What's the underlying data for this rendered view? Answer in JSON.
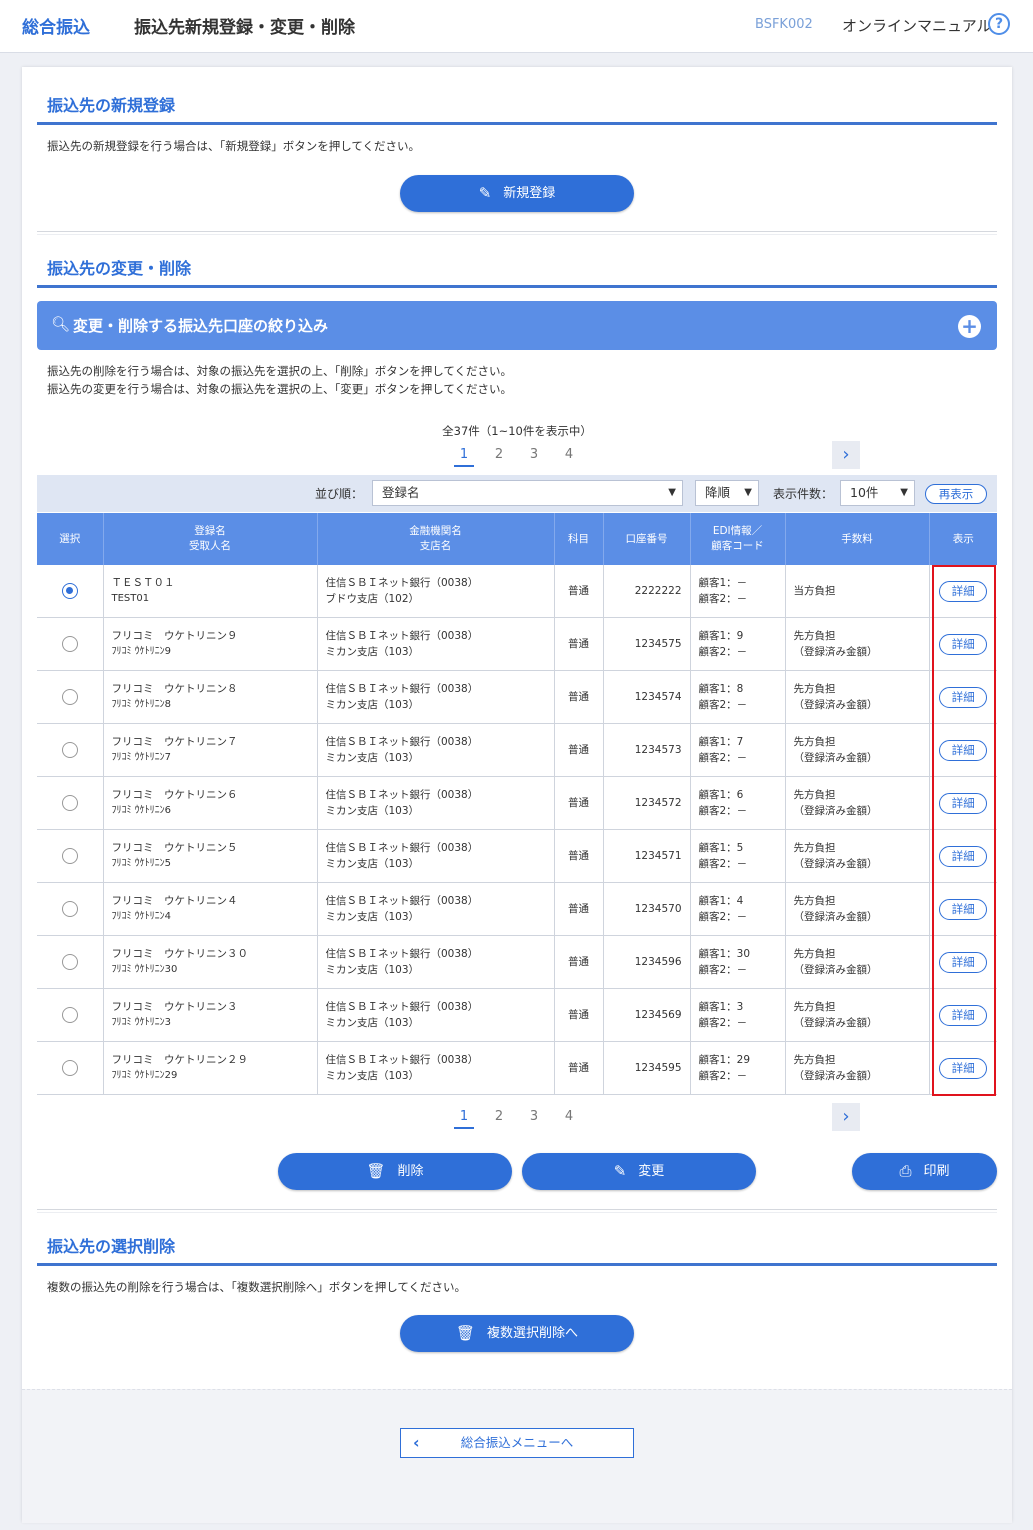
{
  "header": {
    "app_name": "総合振込",
    "screen_title": "振込先新規登録・変更・削除",
    "screen_code": "BSFK002",
    "manual_label": "オンラインマニュアル",
    "help_icon": "?"
  },
  "new_section": {
    "title": "振込先の新規登録",
    "note": "振込先の新規登録を行う場合は、「新規登録」ボタンを押してください。",
    "button": "新規登録"
  },
  "change_section": {
    "title": "振込先の変更・削除",
    "filter_label": "変更・削除する振込先口座の絞り込み",
    "note1": "振込先の削除を行う場合は、対象の振込先を選択の上、「削除」ボタンを押してください。",
    "note2": "振込先の変更を行う場合は、対象の振込先を選択の上、「変更」ボタンを押してください。",
    "count_text": "全37件（1~10件を表示中）",
    "pages": [
      "1",
      "2",
      "3",
      "4"
    ],
    "current_page": "1",
    "sort_label": "並び順：",
    "sort_value": "登録名",
    "order_value": "降順",
    "per_page_label": "表示件数：",
    "per_page_value": "10件",
    "redisplay": "再表示",
    "columns": {
      "select": "選択",
      "name1": "登録名",
      "name2": "受取人名",
      "bank1": "金融機関名",
      "bank2": "支店名",
      "type": "科目",
      "account": "口座番号",
      "edi1": "EDI情報／",
      "edi2": "顧客コード",
      "fee": "手数料",
      "view": "表示"
    },
    "detail_label": "詳細",
    "rows": [
      {
        "selected": true,
        "name": "ＴＥＳＴ０１",
        "kana": "TEST01",
        "bank": "住信ＳＢＩネット銀行（0038）",
        "branch": "ブドウ支店（102）",
        "type": "普通",
        "account": "2222222",
        "c1": "顧客1：－",
        "c2": "顧客2：－",
        "fee1": "当方負担",
        "fee2": ""
      },
      {
        "selected": false,
        "name": "フリコミ　ウケトリニン９",
        "kana": "ﾌﾘｺﾐ ｳｹﾄﾘﾆﾝ9",
        "bank": "住信ＳＢＩネット銀行（0038）",
        "branch": "ミカン支店（103）",
        "type": "普通",
        "account": "1234575",
        "c1": "顧客1：9",
        "c2": "顧客2：－",
        "fee1": "先方負担",
        "fee2": "（登録済み金額）"
      },
      {
        "selected": false,
        "name": "フリコミ　ウケトリニン８",
        "kana": "ﾌﾘｺﾐ ｳｹﾄﾘﾆﾝ8",
        "bank": "住信ＳＢＩネット銀行（0038）",
        "branch": "ミカン支店（103）",
        "type": "普通",
        "account": "1234574",
        "c1": "顧客1：8",
        "c2": "顧客2：－",
        "fee1": "先方負担",
        "fee2": "（登録済み金額）"
      },
      {
        "selected": false,
        "name": "フリコミ　ウケトリニン７",
        "kana": "ﾌﾘｺﾐ ｳｹﾄﾘﾆﾝ7",
        "bank": "住信ＳＢＩネット銀行（0038）",
        "branch": "ミカン支店（103）",
        "type": "普通",
        "account": "1234573",
        "c1": "顧客1：7",
        "c2": "顧客2：－",
        "fee1": "先方負担",
        "fee2": "（登録済み金額）"
      },
      {
        "selected": false,
        "name": "フリコミ　ウケトリニン６",
        "kana": "ﾌﾘｺﾐ ｳｹﾄﾘﾆﾝ6",
        "bank": "住信ＳＢＩネット銀行（0038）",
        "branch": "ミカン支店（103）",
        "type": "普通",
        "account": "1234572",
        "c1": "顧客1：6",
        "c2": "顧客2：－",
        "fee1": "先方負担",
        "fee2": "（登録済み金額）"
      },
      {
        "selected": false,
        "name": "フリコミ　ウケトリニン５",
        "kana": "ﾌﾘｺﾐ ｳｹﾄﾘﾆﾝ5",
        "bank": "住信ＳＢＩネット銀行（0038）",
        "branch": "ミカン支店（103）",
        "type": "普通",
        "account": "1234571",
        "c1": "顧客1：5",
        "c2": "顧客2：－",
        "fee1": "先方負担",
        "fee2": "（登録済み金額）"
      },
      {
        "selected": false,
        "name": "フリコミ　ウケトリニン４",
        "kana": "ﾌﾘｺﾐ ｳｹﾄﾘﾆﾝ4",
        "bank": "住信ＳＢＩネット銀行（0038）",
        "branch": "ミカン支店（103）",
        "type": "普通",
        "account": "1234570",
        "c1": "顧客1：4",
        "c2": "顧客2：－",
        "fee1": "先方負担",
        "fee2": "（登録済み金額）"
      },
      {
        "selected": false,
        "name": "フリコミ　ウケトリニン３０",
        "kana": "ﾌﾘｺﾐ ｳｹﾄﾘﾆﾝ30",
        "bank": "住信ＳＢＩネット銀行（0038）",
        "branch": "ミカン支店（103）",
        "type": "普通",
        "account": "1234596",
        "c1": "顧客1：30",
        "c2": "顧客2：－",
        "fee1": "先方負担",
        "fee2": "（登録済み金額）"
      },
      {
        "selected": false,
        "name": "フリコミ　ウケトリニン３",
        "kana": "ﾌﾘｺﾐ ｳｹﾄﾘﾆﾝ3",
        "bank": "住信ＳＢＩネット銀行（0038）",
        "branch": "ミカン支店（103）",
        "type": "普通",
        "account": "1234569",
        "c1": "顧客1：3",
        "c2": "顧客2：－",
        "fee1": "先方負担",
        "fee2": "（登録済み金額）"
      },
      {
        "selected": false,
        "name": "フリコミ　ウケトリニン２９",
        "kana": "ﾌﾘｺﾐ ｳｹﾄﾘﾆﾝ29",
        "bank": "住信ＳＢＩネット銀行（0038）",
        "branch": "ミカン支店（103）",
        "type": "普通",
        "account": "1234595",
        "c1": "顧客1：29",
        "c2": "顧客2：－",
        "fee1": "先方負担",
        "fee2": "（登録済み金額）"
      }
    ],
    "delete_button": "削除",
    "change_button": "変更",
    "print_button": "印刷"
  },
  "multi_delete_section": {
    "title": "振込先の選択削除",
    "note": "複数の振込先の削除を行う場合は、「複数選択削除へ」ボタンを押してください。",
    "button": "複数選択削除へ"
  },
  "footer": {
    "back_button": "総合振込メニューへ"
  },
  "colors": {
    "accent": "#2f6fd8",
    "filter_bar": "#5b8ee6",
    "highlight": "#e0131d"
  }
}
